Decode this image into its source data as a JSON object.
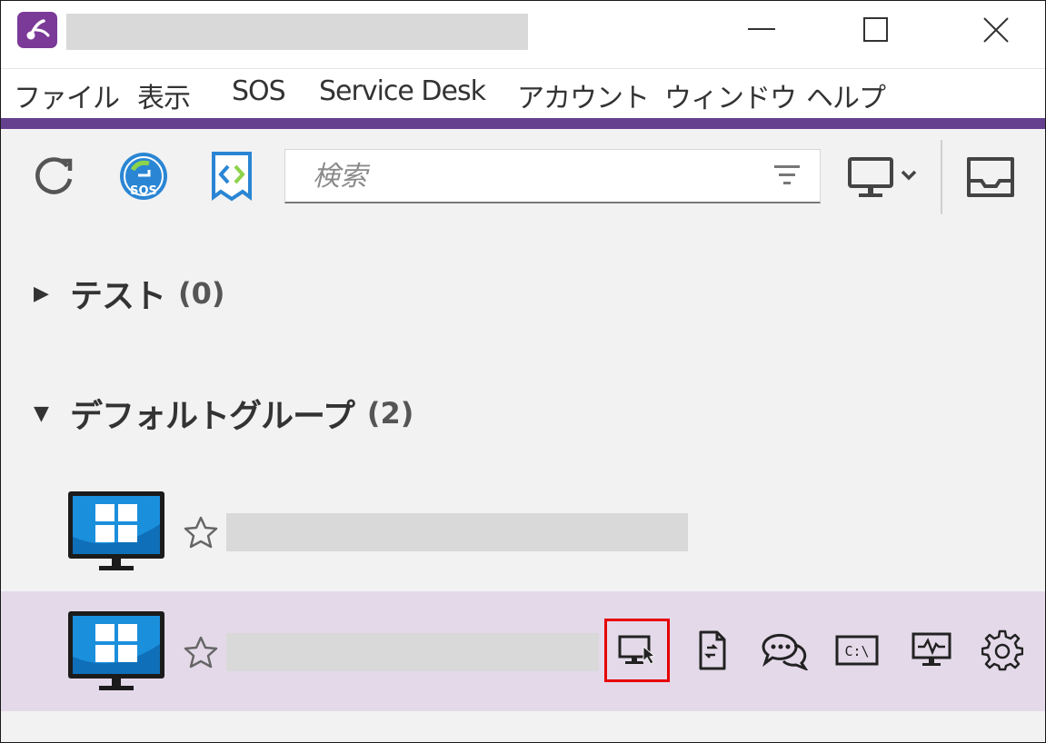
{
  "menu": {
    "items": [
      {
        "id": "file",
        "label": "ファイル"
      },
      {
        "id": "view",
        "label": "表示"
      },
      {
        "id": "sos",
        "label": "SOS"
      },
      {
        "id": "service-desk",
        "label": "Service Desk"
      },
      {
        "id": "account",
        "label": "アカウント"
      },
      {
        "id": "window",
        "label": "ウィンドウ"
      },
      {
        "id": "help",
        "label": "ヘルプ"
      }
    ]
  },
  "toolbar": {
    "sos_badge": "SOS",
    "search_placeholder": "検索"
  },
  "groups": [
    {
      "arrow": "▶",
      "name": "テスト",
      "count": "(0)"
    },
    {
      "arrow": "▼",
      "name": "デフォルトグループ",
      "count": "(2)"
    }
  ],
  "device_actions": {
    "cmd_label": "C:\\"
  },
  "colors": {
    "accent_purple": "#65408e",
    "app_icon": "#7b3a98",
    "selected_row": "#e4d9e9",
    "highlight": "#e60000",
    "windows_blue": "#1a8fdc"
  }
}
